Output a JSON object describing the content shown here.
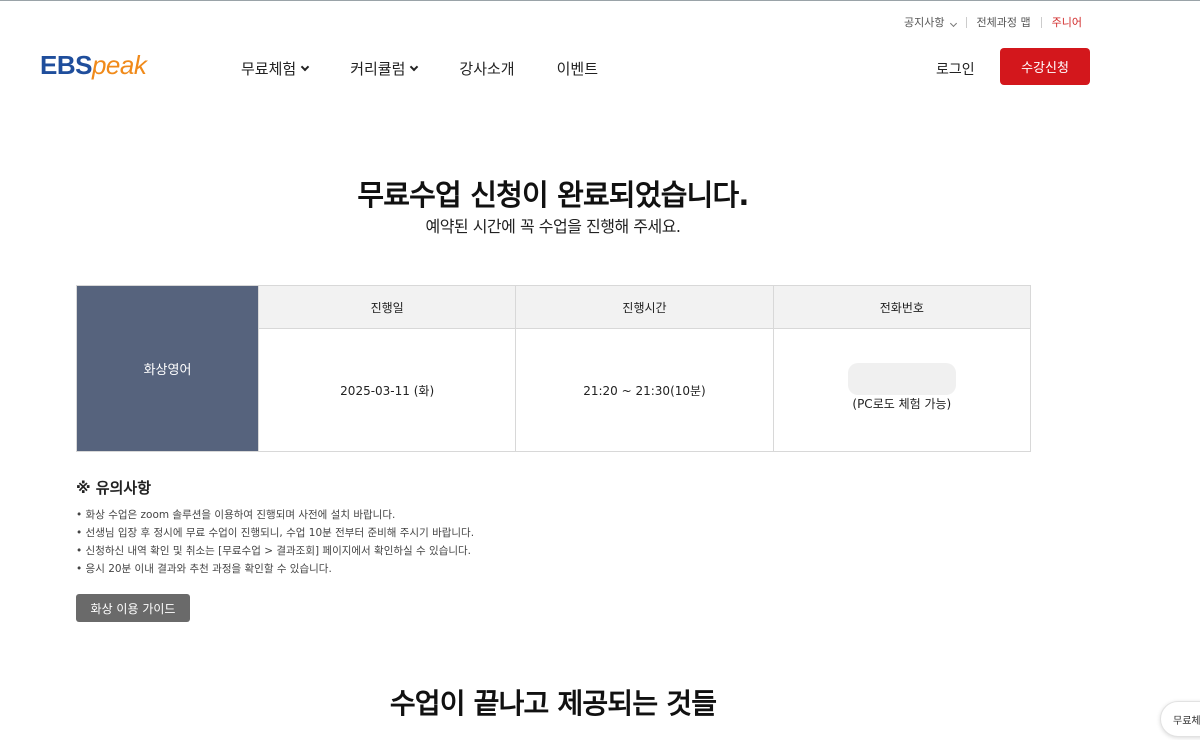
{
  "util_nav": {
    "notice": "공지사항",
    "course_map": "전체과정 맵",
    "junior": "주니어"
  },
  "logo": {
    "ebs": "EBS",
    "peak": "peak"
  },
  "gnb": {
    "items": [
      "무료체험",
      "커리큘럼",
      "강사소개",
      "이벤트"
    ]
  },
  "header": {
    "login": "로그인",
    "apply": "수강신청"
  },
  "main": {
    "heading": "무료수업 신청이 완료되었습니다.",
    "subheading": "예약된 시간에 꼭 수업을 진행해 주세요."
  },
  "table": {
    "course": "화상영어",
    "headers": [
      "진행일",
      "진행시간",
      "전화번호"
    ],
    "date": "2025-03-11 (화)",
    "time": "21:20 ~ 21:30(10분)",
    "phone_note": "(PC로도 체험 가능)"
  },
  "notice": {
    "title": "※ 유의사항",
    "items": [
      "• 화상 수업은 zoom 솔루션을 이용하여 진행되며 사전에 설치 바랍니다.",
      "• 선생님 입장 후 정시에 무료 수업이 진행되니, 수업 10분 전부터 준비해 주시기 바랍니다.",
      "• 신청하신 내역 확인 및 취소는 [무료수업 > 결과조회] 페이지에서 확인하실 수 있습니다.",
      "• 응시 20분 이내 결과와 추천 과정을 확인할 수 있습니다."
    ],
    "guide_button": "화상 이용 가이드"
  },
  "section2": {
    "title": "수업이 끝나고 제공되는 것들"
  },
  "floating": {
    "label": "무료체"
  },
  "colors": {
    "brand_red": "#d3171c",
    "course_bg": "#56637d",
    "logo_blue": "#1f4e9c",
    "logo_orange": "#f08a1a"
  }
}
